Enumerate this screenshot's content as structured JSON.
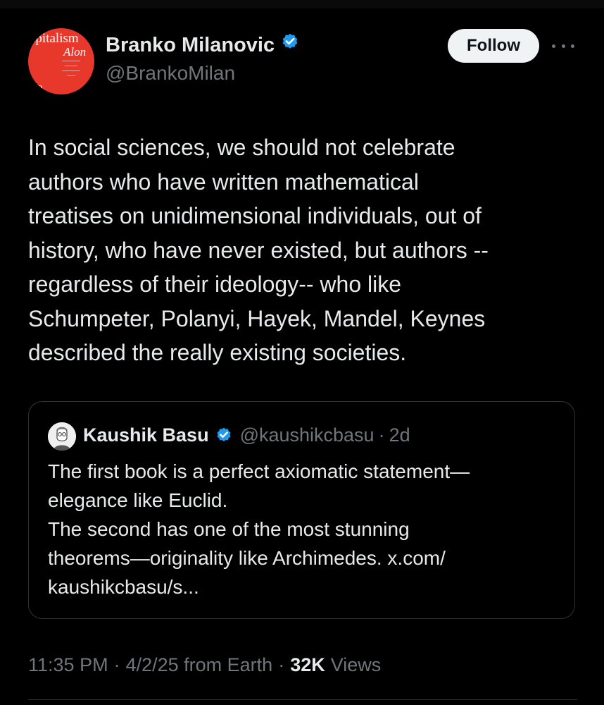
{
  "tweet": {
    "author": {
      "name": "Branko Milanovic",
      "handle": "@BrankoMilan",
      "avatar_text": [
        "apitalism",
        "Alon",
        "nko"
      ]
    },
    "follow_label": "Follow",
    "text": "In social sciences, we should not celebrate\nauthors who have written mathematical\ntreatises on unidimensional individuals, out of\nhistory, who have never existed, but authors --\nregardless of their ideology-- who like\nSchumpeter, Polanyi, Hayek, Mandel, Keynes\ndescribed the really existing societies.",
    "quote": {
      "name": "Kaushik Basu",
      "handle": "@kaushikcbasu",
      "separator": "·",
      "time": "2d",
      "text": "The first book is a perfect axiomatic statement—\nelegance like Euclid.\nThe second has one of the most stunning\ntheorems—originality like Archimedes. x.com/\nkaushikcbasu/s..."
    },
    "meta": {
      "time": "11:35 PM",
      "date_source": "4/2/25 from Earth",
      "separator": "·",
      "views_count": "32K",
      "views_label": "Views"
    }
  },
  "icons": {
    "verified_badge": "verified-badge-icon",
    "more": "more-icon"
  },
  "colors": {
    "background": "#000000",
    "text_primary": "#e7e9ea",
    "text_secondary": "#71767b",
    "verified_blue": "#1d9bf0",
    "follow_bg": "#eff3f4",
    "avatar_red": "#e8382b",
    "border": "#2f3336"
  }
}
